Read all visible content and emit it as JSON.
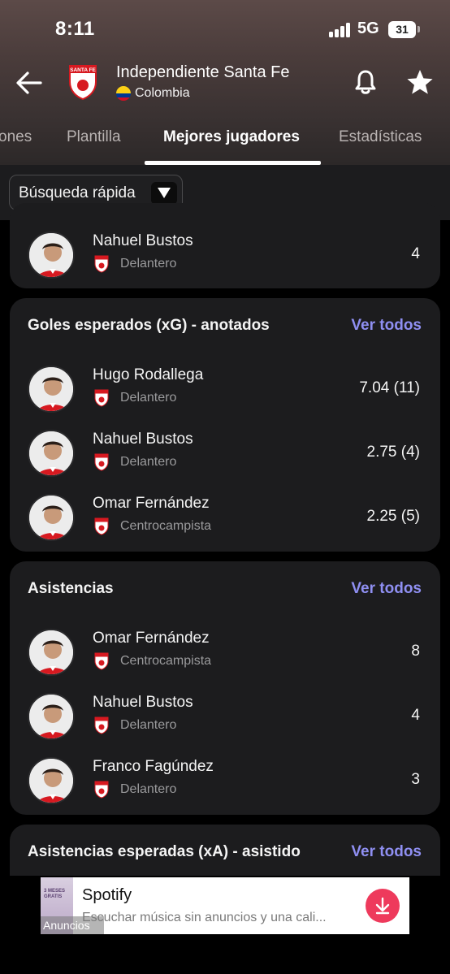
{
  "status_bar": {
    "time": "8:11",
    "network": "5G",
    "battery": "31"
  },
  "header": {
    "team_name": "Independiente Santa Fe",
    "country": "Colombia",
    "club_logo_text": "SANTA FE",
    "icons": {
      "back": "arrow-left-icon",
      "bell": "bell-icon",
      "star": "star-icon",
      "flag": "colombia-flag-icon"
    }
  },
  "tabs": [
    {
      "label": "ones"
    },
    {
      "label": "Plantilla"
    },
    {
      "label": "Mejores jugadores",
      "active": true
    },
    {
      "label": "Estadísticas"
    }
  ],
  "filter": {
    "label": "Búsqueda rápida"
  },
  "cards": [
    {
      "title": "",
      "see_all": "",
      "players": [
        {
          "name": "Nahuel Bustos",
          "position": "Delantero",
          "stat": "4"
        }
      ]
    },
    {
      "title": "Goles esperados (xG) - anotados",
      "see_all": "Ver todos",
      "players": [
        {
          "name": "Hugo Rodallega",
          "position": "Delantero",
          "stat": "7.04 (11)"
        },
        {
          "name": "Nahuel Bustos",
          "position": "Delantero",
          "stat": "2.75 (4)"
        },
        {
          "name": "Omar Fernández",
          "position": "Centrocampista",
          "stat": "2.25 (5)"
        }
      ]
    },
    {
      "title": "Asistencias",
      "see_all": "Ver todos",
      "players": [
        {
          "name": "Omar Fernández",
          "position": "Centrocampista",
          "stat": "8"
        },
        {
          "name": "Nahuel Bustos",
          "position": "Delantero",
          "stat": "4"
        },
        {
          "name": "Franco Fagúndez",
          "position": "Delantero",
          "stat": "3"
        }
      ]
    },
    {
      "title": "Asistencias esperadas (xA) - asistido",
      "see_all": "Ver todos",
      "players": []
    }
  ],
  "ad": {
    "title": "Spotify",
    "subtitle": "Escuchar música sin anuncios y una cali...",
    "label": "Anuncios",
    "thumb_text": "3 MESES GRATIS"
  },
  "colors": {
    "accent": "#8f8ff2",
    "card_bg": "#1c1c1e",
    "club_red": "#d71920",
    "ad_button": "#ee3a5c"
  }
}
